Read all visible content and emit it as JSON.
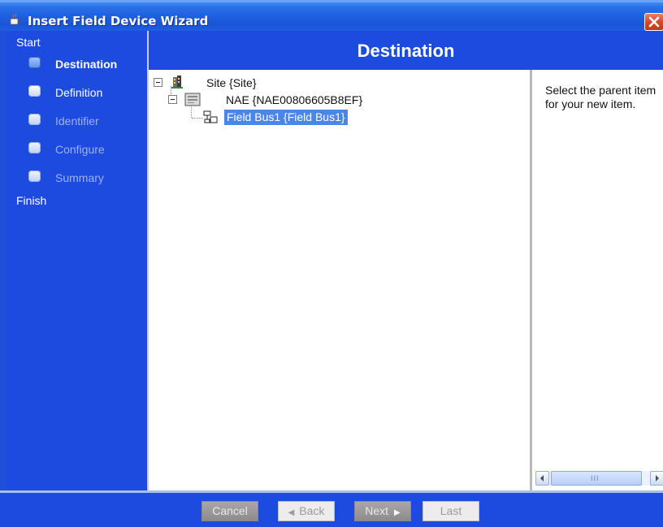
{
  "window": {
    "title": "Insert Field Device Wizard",
    "icons": {
      "app": "java-cup-icon",
      "close": "close-icon"
    }
  },
  "steps": {
    "start_label": "Start",
    "finish_label": "Finish",
    "items": [
      {
        "label": "Destination",
        "state": "active"
      },
      {
        "label": "Definition",
        "state": "enabled"
      },
      {
        "label": "Identifier",
        "state": "disabled"
      },
      {
        "label": "Configure",
        "state": "disabled"
      },
      {
        "label": "Summary",
        "state": "disabled"
      }
    ]
  },
  "header": {
    "title": "Destination"
  },
  "tree": {
    "nodes": [
      {
        "label": "Site {Site}",
        "icon": "building-icon",
        "expanded": true
      },
      {
        "label": "NAE {NAE00806605B8EF}",
        "icon": "server-icon",
        "expanded": true
      },
      {
        "label": "Field Bus1 {Field Bus1}",
        "icon": "network-icon",
        "selected": true
      }
    ]
  },
  "help": {
    "text": "Select the parent item for your new item."
  },
  "scrollbar": {
    "thumb_grip": "III"
  },
  "buttons": {
    "cancel": "Cancel",
    "back": "Back",
    "next": "Next",
    "last": "Last"
  },
  "colors": {
    "wizard_blue": "#1d4be0",
    "selection": "#4a86e8",
    "titlebar": "#2a6fe8"
  }
}
